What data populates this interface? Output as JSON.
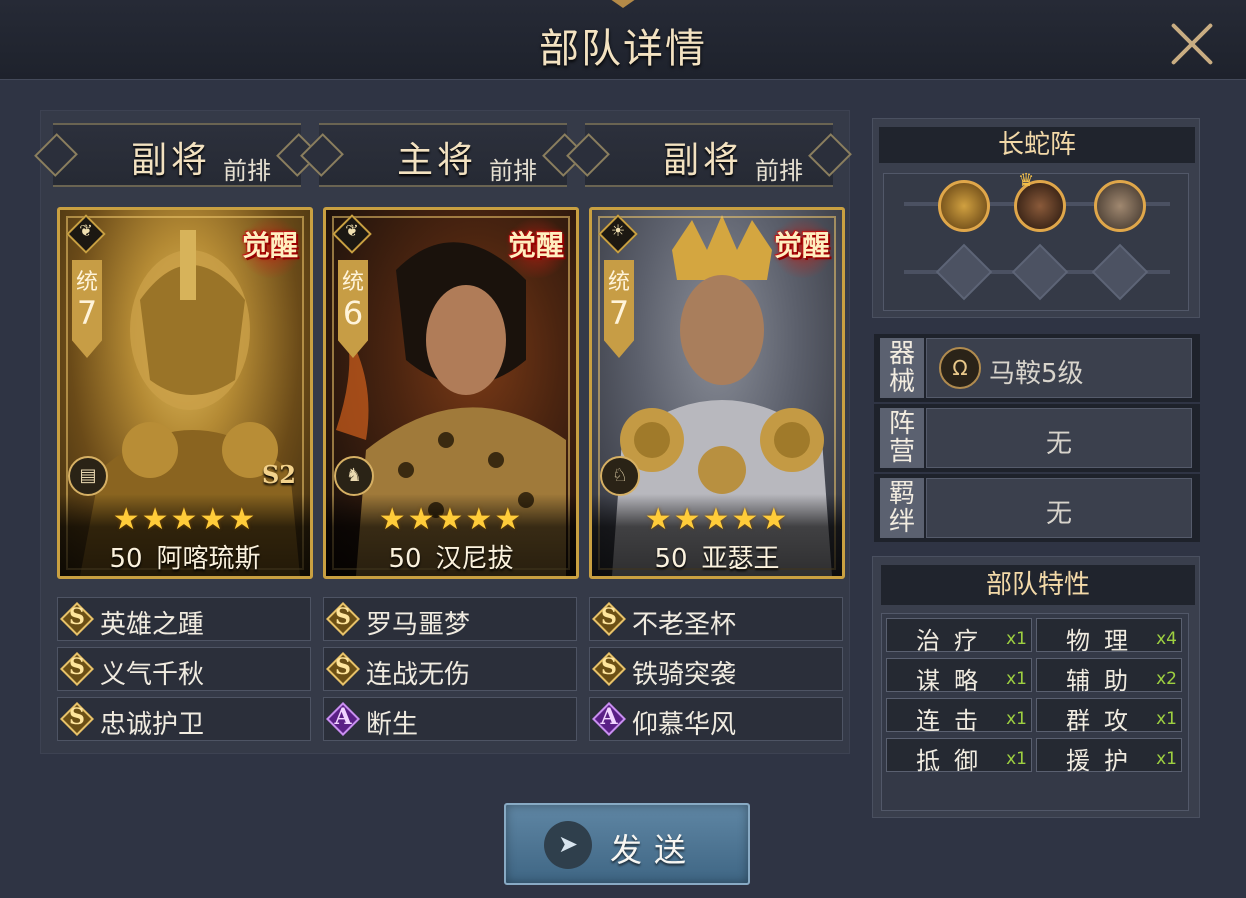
{
  "header": {
    "title": "部队详情",
    "close_icon": "close-icon"
  },
  "heroes": [
    {
      "role": "副将",
      "position": "前排",
      "command_label": "统",
      "command_value": "7",
      "awaken_label": "觉醒",
      "type_icon": "army-banner-icon",
      "season": "S2",
      "stars": "★★★★★",
      "level": "50",
      "name": "阿喀琉斯",
      "palette": [
        "#7a5a22",
        "#c79d45",
        "#4a3510"
      ],
      "skills": [
        {
          "grade": "S",
          "name": "英雄之踵"
        },
        {
          "grade": "S",
          "name": "义气千秋"
        },
        {
          "grade": "S",
          "name": "忠诚护卫"
        }
      ]
    },
    {
      "role": "主将",
      "position": "前排",
      "command_label": "统",
      "command_value": "6",
      "awaken_label": "觉醒",
      "type_icon": "elephant-icon",
      "season": "",
      "stars": "★★★★★",
      "level": "50",
      "name": "汉尼拔",
      "palette": [
        "#3c2212",
        "#8a4a1c",
        "#1e120a"
      ],
      "skills": [
        {
          "grade": "S",
          "name": "罗马噩梦"
        },
        {
          "grade": "S",
          "name": "连战无伤"
        },
        {
          "grade": "A",
          "name": "断生"
        }
      ]
    },
    {
      "role": "副将",
      "position": "前排",
      "command_label": "统",
      "command_value": "7",
      "awaken_label": "觉醒",
      "type_icon": "horse-icon",
      "season": "",
      "stars": "★★★★★",
      "level": "50",
      "name": "亚瑟王",
      "palette": [
        "#6a6e78",
        "#c4a45a",
        "#2a2c34"
      ],
      "skills": [
        {
          "grade": "S",
          "name": "不老圣杯"
        },
        {
          "grade": "S",
          "name": "铁骑突袭"
        },
        {
          "grade": "A",
          "name": "仰慕华风"
        }
      ]
    }
  ],
  "formation": {
    "name": "长蛇阵",
    "crown_icon": "crown-icon",
    "slot_icon": "helmet-slot-icon"
  },
  "properties": {
    "equipment": {
      "label": "器械",
      "value": "马鞍5级",
      "icon": "saddle-icon"
    },
    "camp": {
      "label": "阵营",
      "value": "无"
    },
    "bond": {
      "label": "羁绊",
      "value": "无"
    }
  },
  "traits": {
    "title": "部队特性",
    "items": [
      {
        "name": "治疗",
        "count": "x1"
      },
      {
        "name": "物理",
        "count": "x4"
      },
      {
        "name": "谋略",
        "count": "x1"
      },
      {
        "name": "辅助",
        "count": "x2"
      },
      {
        "name": "连击",
        "count": "x1"
      },
      {
        "name": "群攻",
        "count": "x1"
      },
      {
        "name": "抵御",
        "count": "x1"
      },
      {
        "name": "援护",
        "count": "x1"
      }
    ]
  },
  "send_button": {
    "label": "发送",
    "icon": "paper-plane-icon"
  }
}
